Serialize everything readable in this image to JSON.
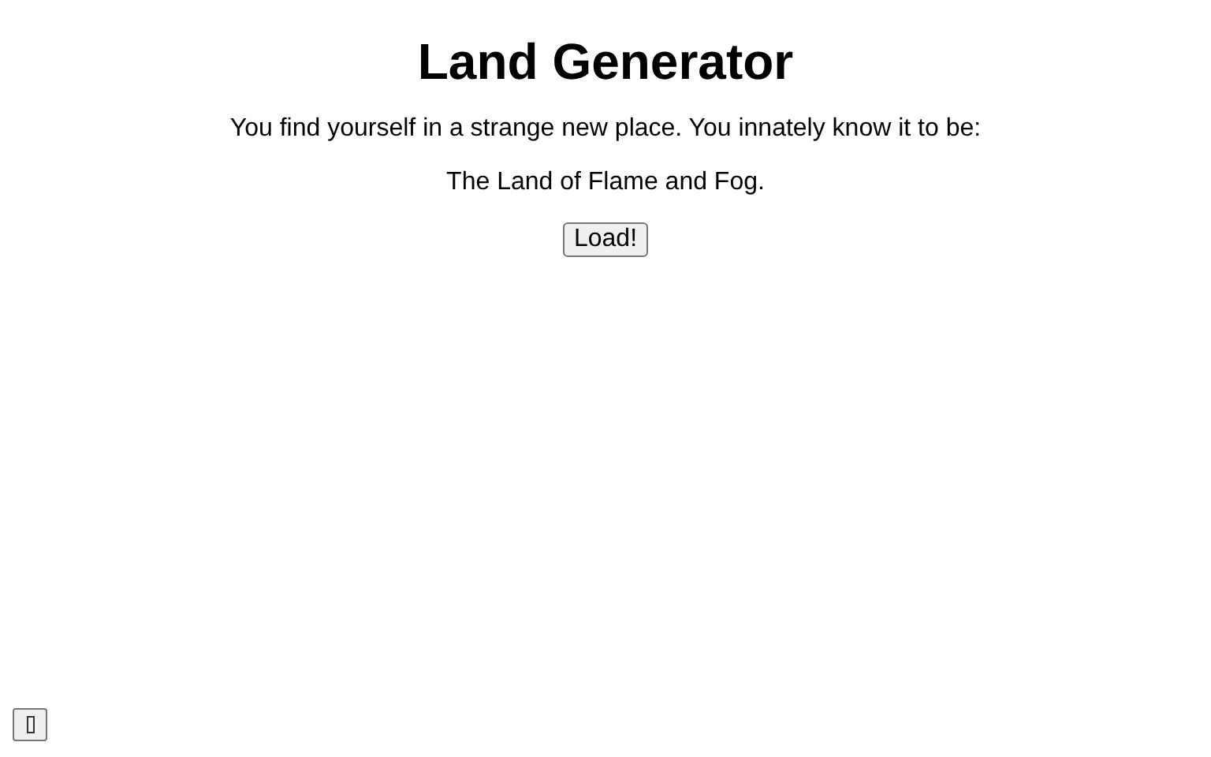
{
  "title": "Land Generator",
  "intro": "You find yourself in a strange new place. You innately know it to be:",
  "land": "The Land of Flame and Fog.",
  "load_button": "Load!"
}
